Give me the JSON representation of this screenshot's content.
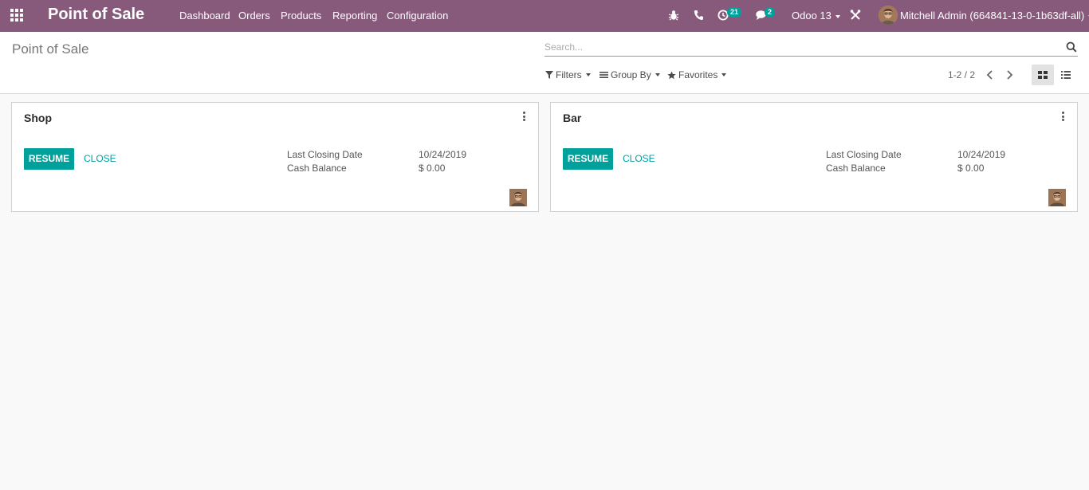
{
  "navbar": {
    "app_title": "Point of Sale",
    "menu": [
      "Dashboard",
      "Orders",
      "Products",
      "Reporting",
      "Configuration"
    ],
    "activity_count": "21",
    "message_count": "2",
    "company": "Odoo 13",
    "user": "Mitchell Admin (664841-13-0-1b63df-all)"
  },
  "control_panel": {
    "breadcrumb": "Point of Sale",
    "search_placeholder": "Search...",
    "filters_label": "Filters",
    "group_by_label": "Group By",
    "favorites_label": "Favorites",
    "pager": "1-2 / 2"
  },
  "cards": [
    {
      "title": "Shop",
      "resume_label": "RESUME",
      "close_label": "CLOSE",
      "last_closing_label": "Last Closing Date",
      "last_closing_value": "10/24/2019",
      "cash_balance_label": "Cash Balance",
      "cash_balance_value": "$ 0.00"
    },
    {
      "title": "Bar",
      "resume_label": "RESUME",
      "close_label": "CLOSE",
      "last_closing_label": "Last Closing Date",
      "last_closing_value": "10/24/2019",
      "cash_balance_label": "Cash Balance",
      "cash_balance_value": "$ 0.00"
    }
  ],
  "colors": {
    "navbar": "#875a7b",
    "accent": "#00a09d"
  }
}
